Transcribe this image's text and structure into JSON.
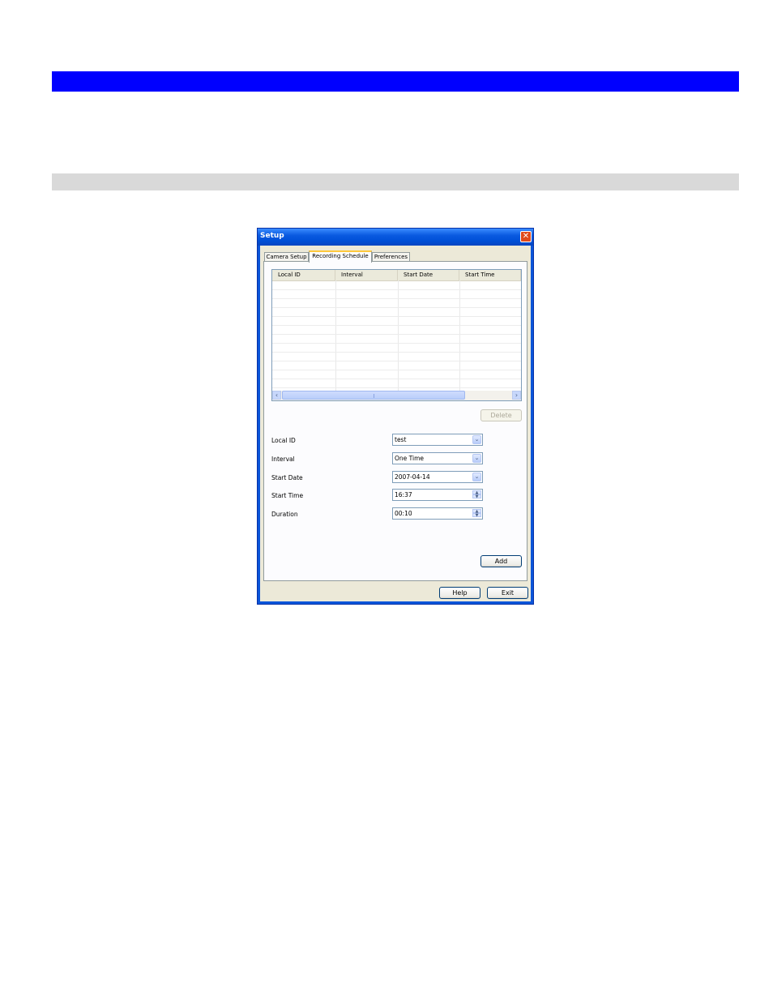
{
  "dialog": {
    "title": "Setup",
    "close_glyph": "✕"
  },
  "tabs": [
    {
      "label": "Camera Setup",
      "active": false
    },
    {
      "label": "Recording Schedule",
      "active": true
    },
    {
      "label": "Preferences",
      "active": false
    }
  ],
  "schedule_list": {
    "columns": [
      "Local ID",
      "Interval",
      "Start Date",
      "Start Time"
    ],
    "rows": []
  },
  "buttons": {
    "delete": "Delete",
    "add": "Add",
    "help": "Help",
    "exit": "Exit"
  },
  "form": {
    "local_id": {
      "label": "Local ID",
      "value": "test"
    },
    "interval": {
      "label": "Interval",
      "value": "One Time"
    },
    "start_date": {
      "label": "Start Date",
      "value": "2007-04-14"
    },
    "start_time": {
      "label": "Start Time",
      "value": "16:37"
    },
    "duration": {
      "label": "Duration",
      "value": "00:10"
    }
  },
  "glyphs": {
    "dropdown": "⌄",
    "scroll_left": "‹",
    "scroll_right": "›",
    "spin_up": "▲",
    "spin_down": "▼"
  },
  "colors": {
    "banner": "#0000ff",
    "subbar": "#d9d9d9",
    "xp_title": "#0a5ae0"
  }
}
